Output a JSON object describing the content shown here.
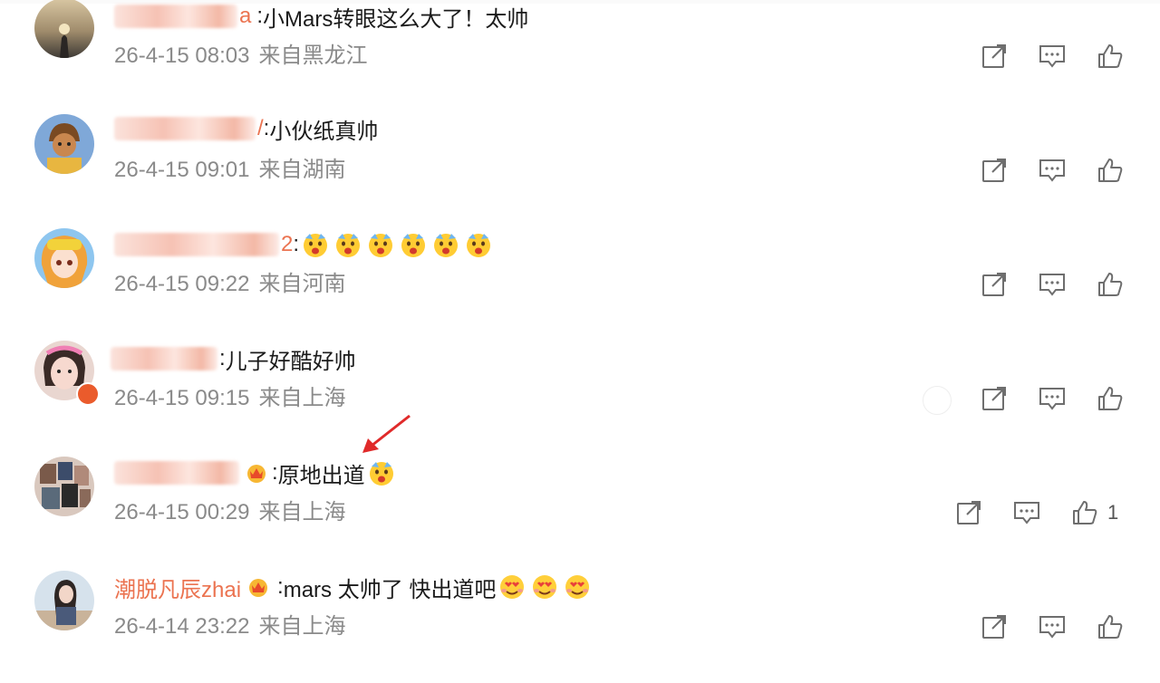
{
  "colors": {
    "username_orange": "#eb7350",
    "meta_gray": "#8a8a8a",
    "icon_gray": "#6e6e6e",
    "annotation_red": "#e02a2a"
  },
  "comments": [
    {
      "username_visible": "a",
      "name_blurred": true,
      "separator": ":",
      "text": "小Mars转眼这么大了！太帅",
      "emojis": [],
      "time": "26-4-15 08:03",
      "source": "来自黑龙江",
      "avatar_icon": "sunset-silhouette-avatar",
      "likes": ""
    },
    {
      "username_visible": "/",
      "name_blurred": true,
      "separator": ":",
      "text": "小伙纸真帅",
      "emojis": [],
      "time": "26-4-15 09:01",
      "source": "来自湖南",
      "avatar_icon": "cartoon-character-avatar",
      "likes": ""
    },
    {
      "username_visible": "2",
      "name_blurred": true,
      "separator": ":",
      "text": "",
      "emojis": [
        "wow-emoji",
        "wow-emoji",
        "wow-emoji",
        "wow-emoji",
        "wow-emoji",
        "wow-emoji"
      ],
      "time": "26-4-15 09:22",
      "source": "来自河南",
      "avatar_icon": "anime-girl-avatar",
      "likes": ""
    },
    {
      "username_visible": "",
      "name_blurred": true,
      "separator": ":",
      "text": "儿子好酷好帅",
      "emojis": [],
      "time": "26-4-15 09:15",
      "source": "来自上海",
      "avatar_icon": "girl-photo-avatar",
      "likes": ""
    },
    {
      "username_visible": "",
      "name_blurred": true,
      "separator": ":",
      "text": "原地出道",
      "emojis": [
        "wow-emoji"
      ],
      "time": "26-4-15 00:29",
      "source": "来自上海",
      "avatar_icon": "collage-avatar",
      "likes": "1"
    },
    {
      "username_visible": "潮脱凡辰zhai",
      "name_blurred": false,
      "separator": ":",
      "text": "mars 太帅了 快出道吧",
      "emojis": [
        "heart-eyes-emoji",
        "heart-eyes-emoji",
        "heart-eyes-emoji"
      ],
      "time": "26-4-14 23:22",
      "source": "来自上海",
      "avatar_icon": "woman-photo-avatar",
      "likes": ""
    }
  ]
}
